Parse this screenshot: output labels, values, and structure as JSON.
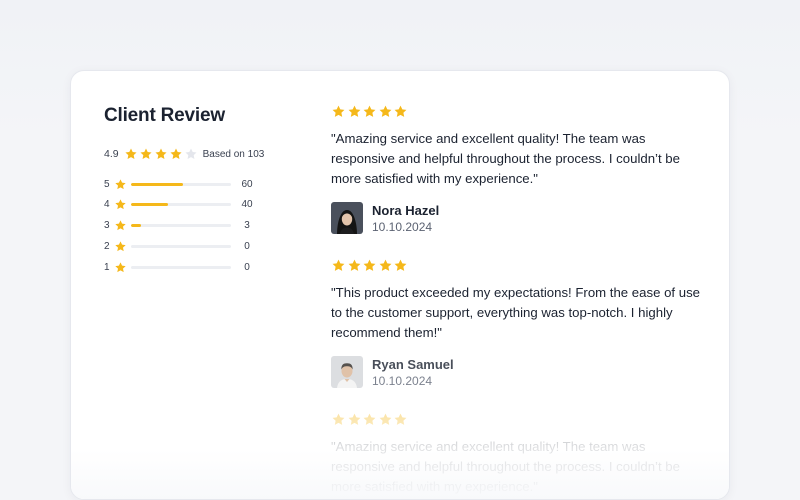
{
  "colors": {
    "star": "#f5b81a",
    "star_empty": "#e4e6ec",
    "text": "#1b2230",
    "muted": "#5b6272"
  },
  "summary": {
    "title": "Client Review",
    "average": "4.9",
    "rating_stars": 4,
    "based_on": "Based on 103"
  },
  "breakdown": [
    {
      "stars": "5",
      "count": "60",
      "fraction": 0.52
    },
    {
      "stars": "4",
      "count": "40",
      "fraction": 0.37
    },
    {
      "stars": "3",
      "count": "3",
      "fraction": 0.1
    },
    {
      "stars": "2",
      "count": "0",
      "fraction": 0
    },
    {
      "stars": "1",
      "count": "0",
      "fraction": 0
    }
  ],
  "reviews": [
    {
      "rating": 5,
      "text": "\"Amazing service and excellent quality! The team was responsive and helpful throughout the process. I couldn’t be more satisfied with my experience.\"",
      "name": "Nora Hazel",
      "date": "10.10.2024"
    },
    {
      "rating": 5,
      "text": "\"This product exceeded my expectations! From the ease of use to the customer support, everything was top-notch. I highly recommend them!\"",
      "name": "Ryan Samuel",
      "date": "10.10.2024"
    },
    {
      "rating": 5,
      "text": "\"Amazing service and excellent quality! The team was responsive and helpful throughout the process. I couldn’t be more satisfied with my experience.\"",
      "name": "",
      "date": ""
    }
  ]
}
